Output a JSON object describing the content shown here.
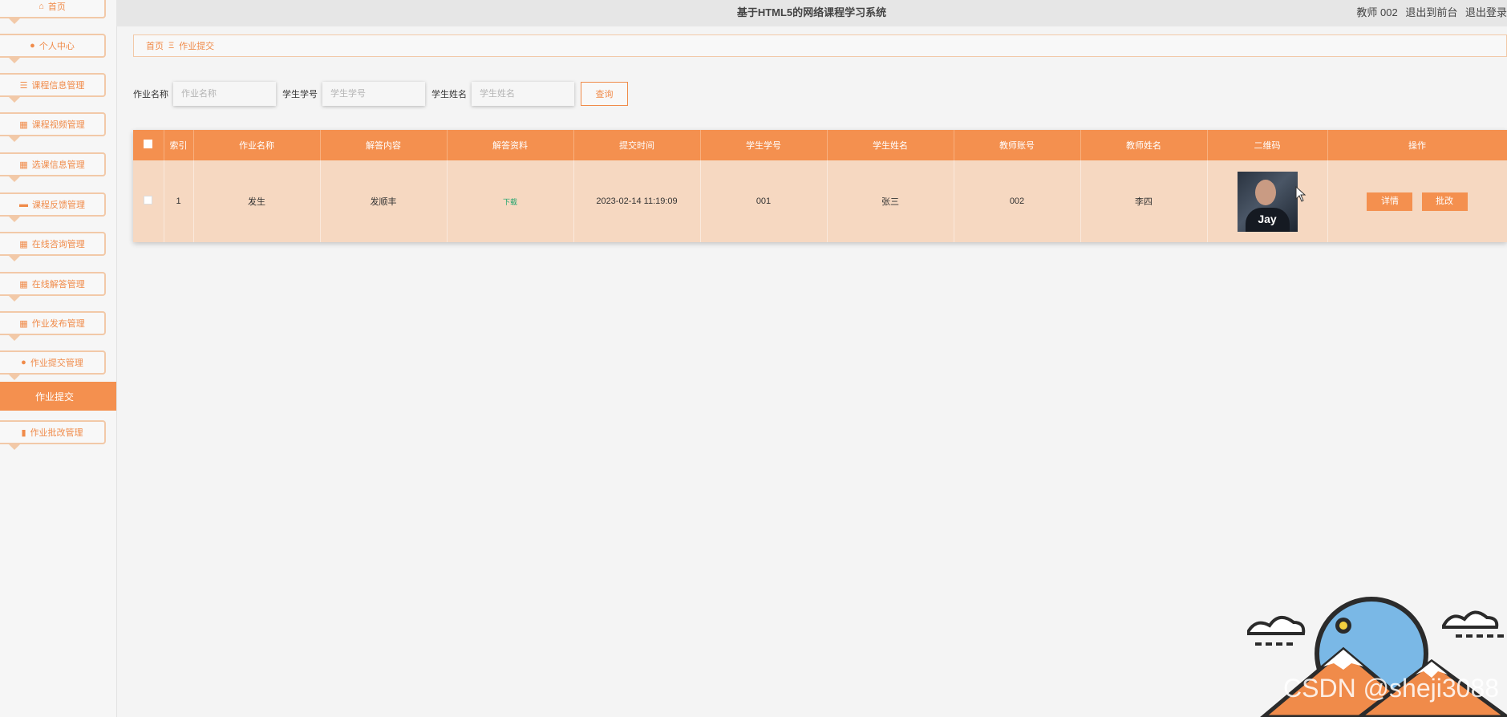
{
  "header": {
    "title": "基于HTML5的网络课程学习系统",
    "user": "教师 002",
    "to_front": "退出到前台",
    "logout": "退出登录"
  },
  "sidebar": {
    "items": [
      {
        "label": "首页",
        "icon": "home-icon"
      },
      {
        "label": "个人中心",
        "icon": "user-icon"
      },
      {
        "label": "课程信息管理",
        "icon": "list-icon"
      },
      {
        "label": "课程视频管理",
        "icon": "grid-icon"
      },
      {
        "label": "选课信息管理",
        "icon": "grid-icon"
      },
      {
        "label": "课程反馈管理",
        "icon": "comment-icon"
      },
      {
        "label": "在线咨询管理",
        "icon": "grid-icon"
      },
      {
        "label": "在线解答管理",
        "icon": "grid-icon"
      },
      {
        "label": "作业发布管理",
        "icon": "grid-icon"
      },
      {
        "label": "作业提交管理",
        "icon": "location-icon"
      },
      {
        "label": "作业批改管理",
        "icon": "clipboard-icon"
      }
    ],
    "active_sub": "作业提交"
  },
  "breadcrumb": {
    "home": "首页",
    "sep": "Ξ",
    "current": "作业提交"
  },
  "search": {
    "name_label": "作业名称",
    "name_placeholder": "作业名称",
    "student_no_label": "学生学号",
    "student_no_placeholder": "学生学号",
    "student_name_label": "学生姓名",
    "student_name_placeholder": "学生姓名",
    "query": "查询"
  },
  "table": {
    "columns": [
      "索引",
      "作业名称",
      "解答内容",
      "解答资料",
      "提交时间",
      "学生学号",
      "学生姓名",
      "教师账号",
      "教师姓名",
      "二维码",
      "操作"
    ],
    "rows": [
      {
        "index": "1",
        "name": "发生",
        "content": "发顺丰",
        "file": "下载",
        "time": "2023-02-14 11:19:09",
        "student_no": "001",
        "student_name": "张三",
        "teacher_no": "002",
        "teacher_name": "李四",
        "qr_text": "Jay",
        "detail": "详情",
        "grade": "批改"
      }
    ]
  },
  "watermark": "CSDN @sheji3088",
  "colors": {
    "accent": "#f4904f",
    "row": "#f6d8c1",
    "download": "#1aa36b"
  }
}
